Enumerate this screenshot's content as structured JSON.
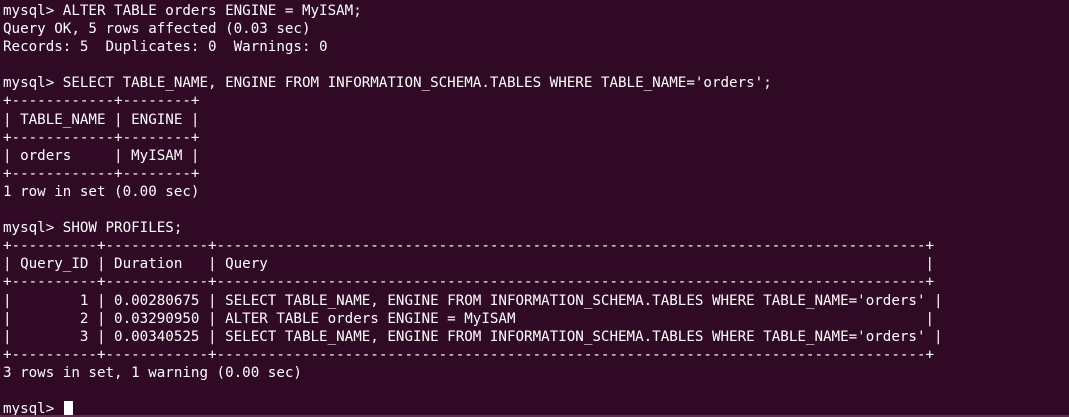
{
  "terminal": {
    "colors": {
      "background": "#300a24",
      "foreground": "#ffffff"
    },
    "lines": [
      "mysql> ALTER TABLE orders ENGINE = MyISAM;",
      "Query OK, 5 rows affected (0.03 sec)",
      "Records: 5  Duplicates: 0  Warnings: 0",
      "",
      "mysql> SELECT TABLE_NAME, ENGINE FROM INFORMATION_SCHEMA.TABLES WHERE TABLE_NAME='orders';",
      "+------------+--------+",
      "| TABLE_NAME | ENGINE |",
      "+------------+--------+",
      "| orders     | MyISAM |",
      "+------------+--------+",
      "1 row in set (0.00 sec)",
      "",
      "mysql> SHOW PROFILES;",
      "+----------+------------+-----------------------------------------------------------------------------------+",
      "| Query_ID | Duration   | Query                                                                             |",
      "+----------+------------+-----------------------------------------------------------------------------------+",
      "|        1 | 0.00280675 | SELECT TABLE_NAME, ENGINE FROM INFORMATION_SCHEMA.TABLES WHERE TABLE_NAME='orders' |",
      "|        2 | 0.03290950 | ALTER TABLE orders ENGINE = MyISAM                                                |",
      "|        3 | 0.00340525 | SELECT TABLE_NAME, ENGINE FROM INFORMATION_SCHEMA.TABLES WHERE TABLE_NAME='orders' |",
      "+----------+------------+-----------------------------------------------------------------------------------+",
      "3 rows in set, 1 warning (0.00 sec)",
      ""
    ],
    "prompt": "mysql> "
  }
}
